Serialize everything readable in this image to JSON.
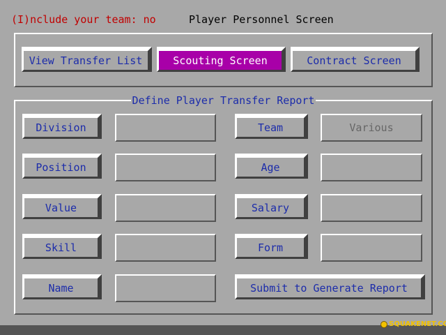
{
  "header": {
    "include_team": "(I)nclude your team: no",
    "title": "Player Personnel Screen"
  },
  "nav": {
    "view_transfer_list": "View Transfer List",
    "scouting_screen": "Scouting Screen",
    "contract_screen": "Contract Screen"
  },
  "report": {
    "title": "Define Player Transfer Report",
    "division_label": "Division",
    "division_value": "",
    "position_label": "Position",
    "position_value": "",
    "value_label": "Value",
    "value_value": "",
    "skill_label": "Skill",
    "skill_value": "",
    "name_label": "Name",
    "name_value": "",
    "team_label": "Team",
    "team_value": "Various",
    "age_label": "Age",
    "age_value": "",
    "salary_label": "Salary",
    "salary_value": "",
    "form_label": "Form",
    "form_value": "",
    "submit_label": "Submit to Generate Report"
  },
  "watermark": {
    "logo_text": "SQUAKENET.COM"
  },
  "colors": {
    "background": "#a8a8a8",
    "label_blue": "#1c2caa",
    "header_red": "#c00000",
    "active_button": "#a800a8",
    "logo_yellow": "#f2c200"
  }
}
